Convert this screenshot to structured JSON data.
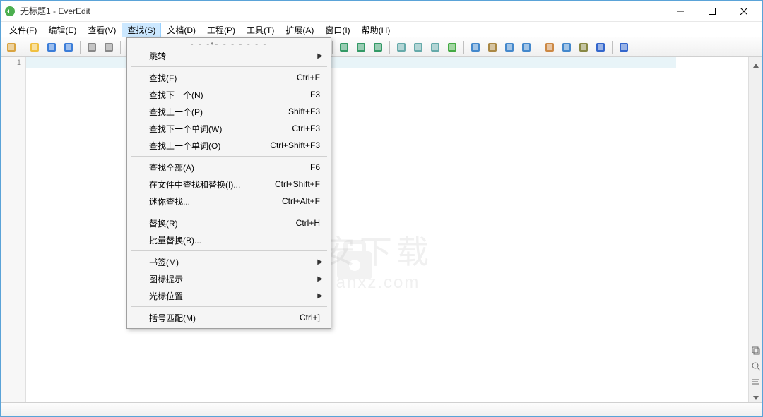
{
  "window": {
    "title": "无标题1 - EverEdit"
  },
  "menubar": {
    "items": [
      {
        "label": "文件(F)"
      },
      {
        "label": "编辑(E)"
      },
      {
        "label": "查看(V)"
      },
      {
        "label": "查找(S)",
        "active": true
      },
      {
        "label": "文档(D)"
      },
      {
        "label": "工程(P)"
      },
      {
        "label": "工具(T)"
      },
      {
        "label": "扩展(A)"
      },
      {
        "label": "窗口(I)"
      },
      {
        "label": "帮助(H)"
      }
    ]
  },
  "dropdown": {
    "groups": [
      [
        {
          "type": "tear"
        },
        {
          "label": "跳转",
          "submenu": true
        }
      ],
      [
        {
          "label": "查找(F)",
          "shortcut": "Ctrl+F"
        },
        {
          "label": "查找下一个(N)",
          "shortcut": "F3"
        },
        {
          "label": "查找上一个(P)",
          "shortcut": "Shift+F3"
        },
        {
          "label": "查找下一个单词(W)",
          "shortcut": "Ctrl+F3"
        },
        {
          "label": "查找上一个单词(O)",
          "shortcut": "Ctrl+Shift+F3"
        }
      ],
      [
        {
          "label": "查找全部(A)",
          "shortcut": "F6"
        },
        {
          "label": "在文件中查找和替换(I)...",
          "shortcut": "Ctrl+Shift+F"
        },
        {
          "label": "迷你查找...",
          "shortcut": "Ctrl+Alt+F"
        }
      ],
      [
        {
          "label": "替换(R)",
          "shortcut": "Ctrl+H"
        },
        {
          "label": "批量替换(B)..."
        }
      ],
      [
        {
          "label": "书签(M)",
          "submenu": true
        },
        {
          "label": "图标提示",
          "submenu": true
        },
        {
          "label": "光标位置",
          "submenu": true
        }
      ],
      [
        {
          "label": "括号匹配(M)",
          "shortcut": "Ctrl+]"
        }
      ]
    ]
  },
  "gutter": {
    "line1": "1"
  },
  "watermark": {
    "cn": "安下载",
    "en": "anxz.com"
  },
  "toolbar_icons": [
    "new",
    "open",
    "save",
    "save-all",
    "undo",
    "redo",
    "cut",
    "copy",
    "paste",
    "find",
    "replace",
    "goto",
    "bookmark",
    "prev-bm",
    "next-bm",
    "col",
    "hex",
    "cmd1",
    "cmd2",
    "cmd3",
    "refresh1",
    "refresh2",
    "refresh3",
    "plugin",
    "window",
    "tool",
    "panel1",
    "panel2",
    "panel3",
    "panel4",
    "web",
    "ie",
    "help"
  ],
  "right_icons": [
    "up",
    "copy",
    "zoom",
    "wrap"
  ]
}
